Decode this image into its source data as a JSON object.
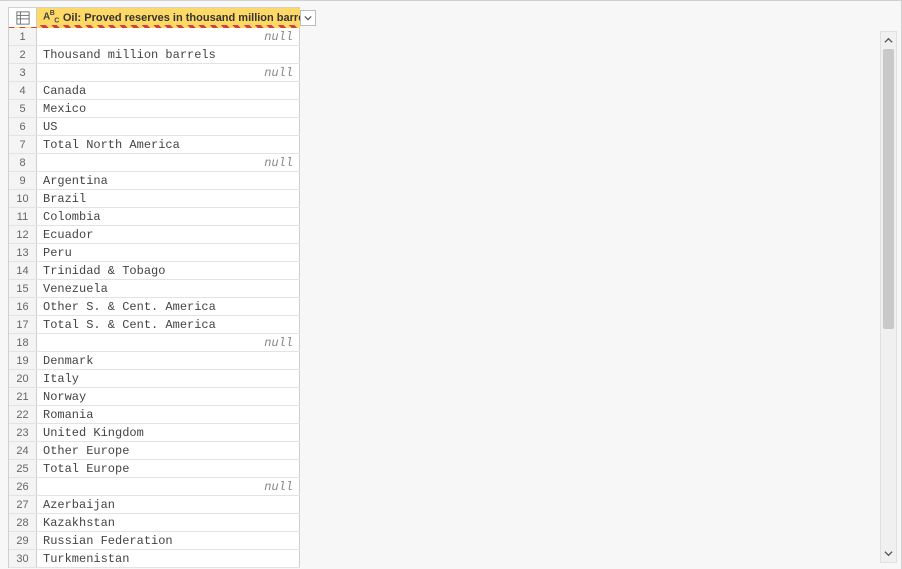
{
  "column": {
    "type_label": "ABC",
    "title": "Oil: Proved reserves in thousand million barrels"
  },
  "null_label": "null",
  "rows": [
    {
      "n": "1",
      "value": null
    },
    {
      "n": "2",
      "value": "Thousand million barrels"
    },
    {
      "n": "3",
      "value": null
    },
    {
      "n": "4",
      "value": "Canada"
    },
    {
      "n": "5",
      "value": "Mexico"
    },
    {
      "n": "6",
      "value": "US"
    },
    {
      "n": "7",
      "value": "Total North America"
    },
    {
      "n": "8",
      "value": null
    },
    {
      "n": "9",
      "value": "Argentina"
    },
    {
      "n": "10",
      "value": "Brazil"
    },
    {
      "n": "11",
      "value": "Colombia"
    },
    {
      "n": "12",
      "value": "Ecuador"
    },
    {
      "n": "13",
      "value": "Peru"
    },
    {
      "n": "14",
      "value": "Trinidad & Tobago"
    },
    {
      "n": "15",
      "value": "Venezuela"
    },
    {
      "n": "16",
      "value": "Other S. & Cent. America"
    },
    {
      "n": "17",
      "value": "Total S. & Cent. America"
    },
    {
      "n": "18",
      "value": null
    },
    {
      "n": "19",
      "value": "Denmark"
    },
    {
      "n": "20",
      "value": "Italy"
    },
    {
      "n": "21",
      "value": "Norway"
    },
    {
      "n": "22",
      "value": "Romania"
    },
    {
      "n": "23",
      "value": "United Kingdom"
    },
    {
      "n": "24",
      "value": "Other Europe"
    },
    {
      "n": "25",
      "value": "Total Europe"
    },
    {
      "n": "26",
      "value": null
    },
    {
      "n": "27",
      "value": "Azerbaijan"
    },
    {
      "n": "28",
      "value": "Kazakhstan"
    },
    {
      "n": "29",
      "value": "Russian Federation"
    },
    {
      "n": "30",
      "value": "Turkmenistan"
    }
  ]
}
